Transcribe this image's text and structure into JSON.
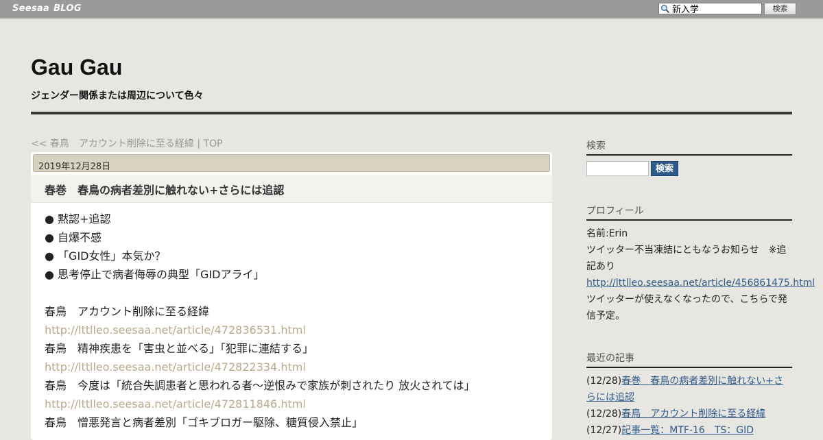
{
  "topbar": {
    "brand_left": "Seesaa",
    "brand_right": "BLOG",
    "search_value": "新入学",
    "search_button": "検索"
  },
  "header": {
    "title": "Gau Gau",
    "description": "ジェンダー関係または周辺について色々"
  },
  "breadcrumb": {
    "prev": "<< 春鳥　アカウント削除に至る経緯",
    "separator": "|",
    "top": "TOP"
  },
  "post": {
    "date": "2019年12月28日",
    "title": "春巻　春鳥の病者差別に触れない+さらには追認",
    "lines": [
      {
        "text": "● 黙認+追認",
        "link": false
      },
      {
        "text": "● 自爆不感",
        "link": false
      },
      {
        "text": "● 「GID女性」本気か？",
        "link": false
      },
      {
        "text": "● 思考停止で病者侮辱の典型「GIDアライ」",
        "link": false
      },
      {
        "text": "",
        "link": false
      },
      {
        "text": "春鳥　アカウント削除に至る経緯",
        "link": false
      },
      {
        "text": "http://lttlleo.seesaa.net/article/472836531.html",
        "link": true
      },
      {
        "text": "春鳥　精神疾患を「害虫と並べる」「犯罪に連結する」",
        "link": false
      },
      {
        "text": "http://lttlleo.seesaa.net/article/472822334.html",
        "link": true
      },
      {
        "text": "春鳥　今度は「統合失調患者と思われる者～逆恨みで家族が刺されたり 放火されては」",
        "link": false
      },
      {
        "text": "http://lttlleo.seesaa.net/article/472811846.html",
        "link": true
      },
      {
        "text": "春鳥　憎悪発言と病者差別「ゴキブロガー駆除、糖質侵入禁止」",
        "link": false
      }
    ]
  },
  "sidebar": {
    "search": {
      "heading": "検索",
      "button": "検索"
    },
    "profile": {
      "heading": "プロフィール",
      "name": "名前:Erin",
      "notice": "ツイッター不当凍結にともなうお知らせ　※追記あり",
      "link": "http://lttlleo.seesaa.net/article/456861475.html",
      "note": "ツイッターが使えなくなったので、こちらで発信予定。"
    },
    "recent": {
      "heading": "最近の記事",
      "items": [
        {
          "date": "(12/28)",
          "title": "春巻　春鳥の病者差別に触れない+さらには追認"
        },
        {
          "date": "(12/28)",
          "title": "春鳥　アカウント削除に至る経緯"
        },
        {
          "date": "(12/27)",
          "title": "記事一覧：MTF-16　TS：GID"
        }
      ]
    }
  },
  "colors": {
    "topbar": "#9a9a9a",
    "page_bg": "#e7e6e1",
    "date_bar": "#d8d3c1",
    "body_link": "#b8a98a",
    "side_link": "#2f5b8c",
    "rule": "#3a3a3a"
  }
}
